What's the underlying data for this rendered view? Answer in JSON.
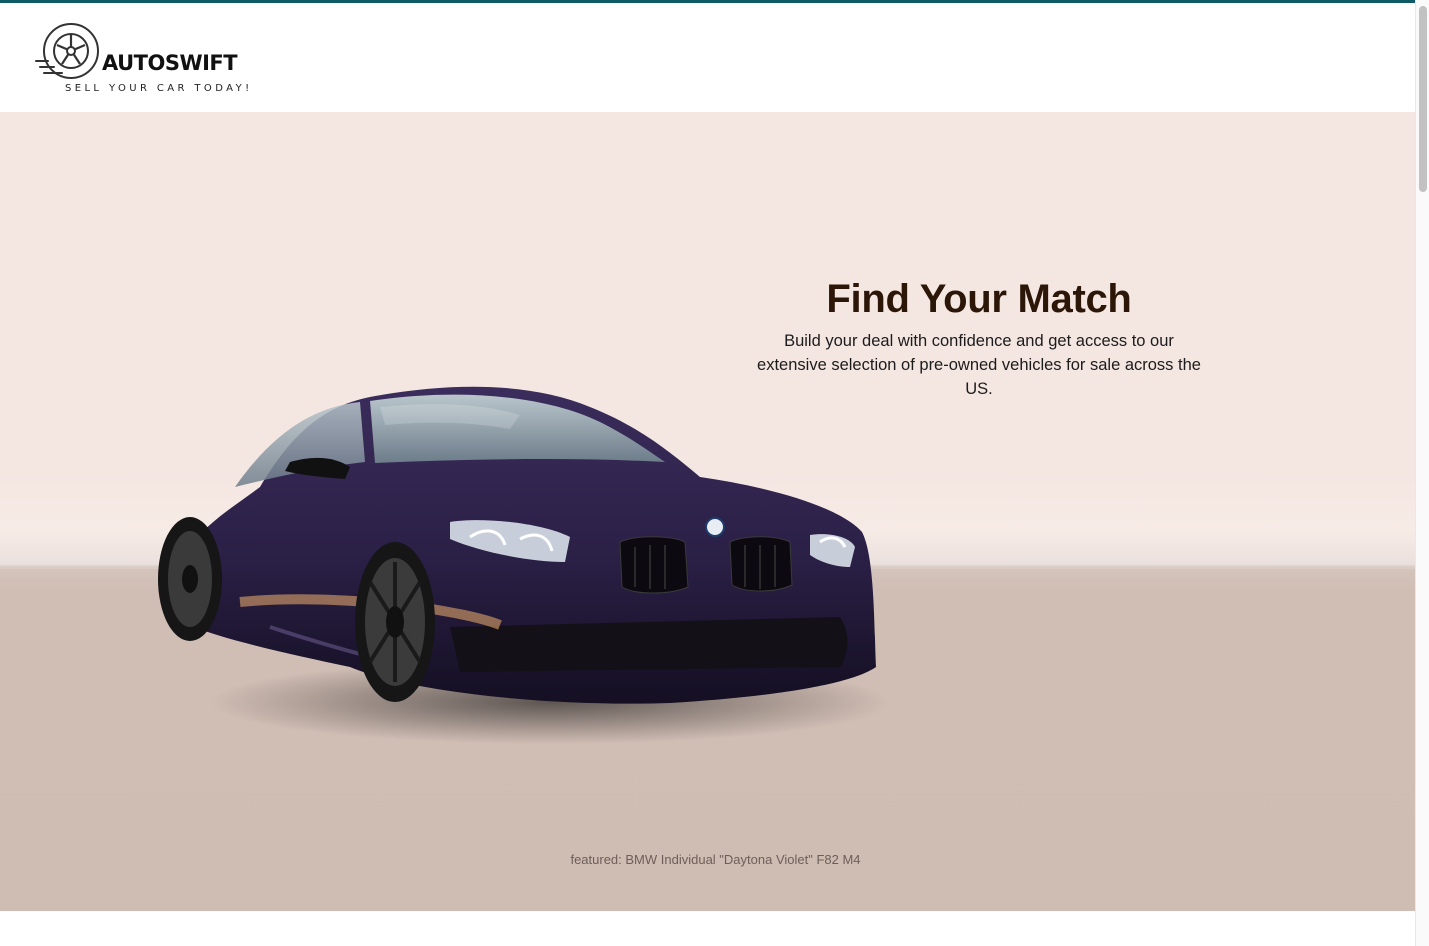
{
  "header": {
    "logo": {
      "wordmark": "AUTOSWIFT",
      "tagline": "SELL YOUR CAR TODAY!",
      "icon": "wheel-icon"
    }
  },
  "hero": {
    "title": "Find Your Match",
    "subtitle": "Build your deal with confidence and get access to our extensive selection of pre-owned vehicles for sale across the US.",
    "caption": "featured: BMW Individual \"Daytona Violet\" F82 M4"
  },
  "colors": {
    "accent": "#0f5a66",
    "hero_top": "#f4e6e1",
    "hero_floor": "#cfbdb4",
    "title": "#2b1608",
    "car_body": "#2b1f45"
  }
}
